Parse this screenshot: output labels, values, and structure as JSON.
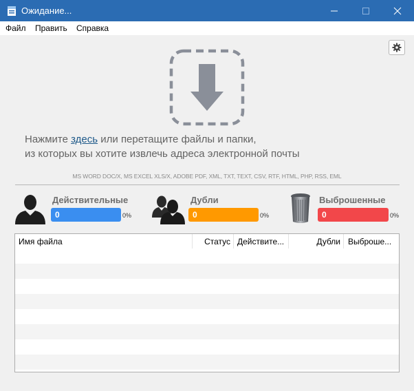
{
  "window": {
    "title": "Ожидание...",
    "controls": [
      "minimize",
      "maximize",
      "close"
    ]
  },
  "menu": {
    "items": [
      "Файл",
      "Править",
      "Справка"
    ]
  },
  "settings_button": {
    "icon": "gear-icon"
  },
  "dropzone": {
    "icon": "download-arrow-icon",
    "text_before": "Нажмите ",
    "link_text": "здесь",
    "text_after": " или перетащите файлы и папки,",
    "line2": "из которых вы хотите извлечь адреса электронной почты",
    "formats": "MS WORD DOC/X, MS EXCEL XLS/X, ADOBE PDF, XML, TXT, TEXT, CSV, RTF, HTML, PHP, RSS, EML"
  },
  "stats": [
    {
      "label": "Действительные",
      "value": "0",
      "percent": "0%",
      "color": "#3a8ef0",
      "icon": "user-icon"
    },
    {
      "label": "Дубли",
      "value": "0",
      "percent": "0%",
      "color": "#ff9900",
      "icon": "users-icon"
    },
    {
      "label": "Выброшенные",
      "value": "0",
      "percent": "0%",
      "color": "#f2474a",
      "icon": "trash-icon"
    }
  ],
  "table": {
    "columns": [
      "Имя файла",
      "Статус",
      "Действите...",
      "Дубли",
      "Выброше..."
    ],
    "rows": []
  }
}
